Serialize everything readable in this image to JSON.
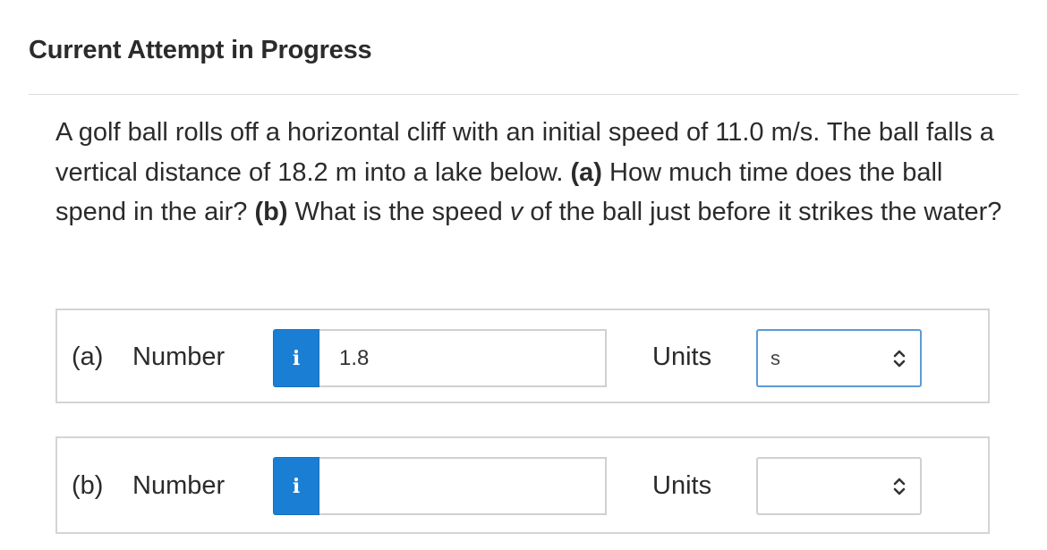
{
  "header": {
    "title": "Current Attempt in Progress"
  },
  "question": {
    "intro": "A golf ball rolls off a horizontal cliff with an initial speed of 11.0 m/s. The ball falls a vertical distance of 18.2 m into a lake below. ",
    "part_a_marker": "(a)",
    "part_a_text": " How much time does the ball spend in the air? ",
    "part_b_marker": "(b)",
    "part_b_text_1": " What is the speed ",
    "variable": "v",
    "part_b_text_2": " of the ball just before it strikes the water?"
  },
  "parts": [
    {
      "label": "(a)",
      "number_label": "Number",
      "info_icon": "i",
      "number_value": "1.8",
      "units_label": "Units",
      "units_value": "s"
    },
    {
      "label": "(b)",
      "number_label": "Number",
      "info_icon": "i",
      "number_value": "",
      "units_label": "Units",
      "units_value": ""
    }
  ],
  "colors": {
    "info_button": "#1a7fd4",
    "focus_border": "#5b9bd5",
    "box_border": "#d4d4d4"
  }
}
